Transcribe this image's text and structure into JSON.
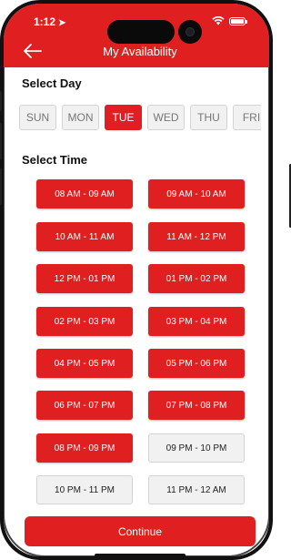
{
  "status_bar": {
    "time": "1:12",
    "icons": [
      "location-arrow-icon",
      "wifi-icon",
      "battery-icon"
    ]
  },
  "header": {
    "title": "My Availability",
    "back_icon": "arrow-left-icon",
    "color": "#e02020"
  },
  "day_section": {
    "title": "Select Day",
    "days": [
      {
        "label": "SUN",
        "selected": false
      },
      {
        "label": "MON",
        "selected": false
      },
      {
        "label": "TUE",
        "selected": true
      },
      {
        "label": "WED",
        "selected": false
      },
      {
        "label": "THU",
        "selected": false
      },
      {
        "label": "FRI",
        "selected": false
      }
    ]
  },
  "time_section": {
    "title": "Select Time",
    "slots": [
      {
        "label": "08 AM - 09 AM",
        "selected": true
      },
      {
        "label": "09 AM - 10 AM",
        "selected": true
      },
      {
        "label": "10 AM - 11 AM",
        "selected": true
      },
      {
        "label": "11 AM - 12 PM",
        "selected": true
      },
      {
        "label": "12 PM - 01 PM",
        "selected": true
      },
      {
        "label": "01 PM - 02 PM",
        "selected": true
      },
      {
        "label": "02 PM - 03 PM",
        "selected": true
      },
      {
        "label": "03 PM - 04 PM",
        "selected": true
      },
      {
        "label": "04 PM - 05 PM",
        "selected": true
      },
      {
        "label": "05 PM - 06 PM",
        "selected": true
      },
      {
        "label": "06 PM - 07 PM",
        "selected": true
      },
      {
        "label": "07 PM - 08 PM",
        "selected": true
      },
      {
        "label": "08 PM - 09 PM",
        "selected": true
      },
      {
        "label": "09 PM - 10 PM",
        "selected": false
      },
      {
        "label": "10 PM - 11 PM",
        "selected": false
      },
      {
        "label": "11 PM - 12 AM",
        "selected": false
      }
    ]
  },
  "footer": {
    "continue_label": "Continue"
  },
  "colors": {
    "accent": "#e02020",
    "unselected_bg": "#f1f1f1",
    "unselected_border": "#d4d4d4"
  }
}
